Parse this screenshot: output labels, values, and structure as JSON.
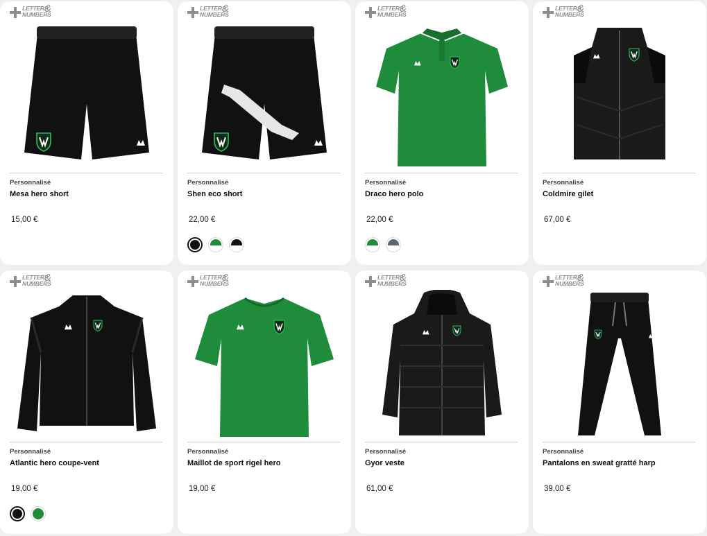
{
  "badge": {
    "line1": "LETTERS",
    "line2": "NUMBERS",
    "amp": "&"
  },
  "products": [
    {
      "tag": "Personnalisé",
      "name": "Mesa hero short",
      "price": "15,00 €",
      "image_icon": "shorts-icon",
      "main_color": "#111111"
    },
    {
      "tag": "Personnalisé",
      "name": "Shen eco short",
      "price": "22,00 €",
      "image_icon": "shorts-icon",
      "main_color": "#111111",
      "swatches": [
        {
          "name": "black",
          "top": "#111111",
          "bottom": "#111111",
          "selected": true
        },
        {
          "name": "green",
          "top": "#1e8c3a",
          "bottom": "#ffffff"
        },
        {
          "name": "black-white",
          "top": "#111111",
          "bottom": "#ffffff"
        }
      ]
    },
    {
      "tag": "Personnalisé",
      "name": "Draco hero polo",
      "price": "22,00 €",
      "image_icon": "polo-icon",
      "main_color": "#1e8c3a",
      "swatches": [
        {
          "name": "green",
          "top": "#1e8c3a",
          "bottom": "#ffffff"
        },
        {
          "name": "grey",
          "top": "#5c6670",
          "bottom": "#ffffff"
        }
      ]
    },
    {
      "tag": "Personnalisé",
      "name": "Coldmire gilet",
      "price": "67,00 €",
      "image_icon": "gilet-icon",
      "main_color": "#1a1a1a"
    },
    {
      "tag": "Personnalisé",
      "name": "Atlantic hero coupe-vent",
      "price": "19,00 €",
      "image_icon": "jacket-icon",
      "main_color": "#111111",
      "swatches": [
        {
          "name": "black",
          "top": "#111111",
          "bottom": "#111111",
          "selected": true
        },
        {
          "name": "green",
          "top": "#1e8c3a",
          "bottom": "#1e8c3a"
        }
      ]
    },
    {
      "tag": "Personnalisé",
      "name": "Maillot de sport rigel hero",
      "price": "19,00 €",
      "image_icon": "tshirt-icon",
      "main_color": "#1e8c3a"
    },
    {
      "tag": "Personnalisé",
      "name": "Gyor veste",
      "price": "61,00 €",
      "image_icon": "parka-icon",
      "main_color": "#1a1a1a"
    },
    {
      "tag": "Personnalisé",
      "name": "Pantalons en sweat gratté harp",
      "price": "39,00 €",
      "image_icon": "pants-icon",
      "main_color": "#111111"
    }
  ]
}
